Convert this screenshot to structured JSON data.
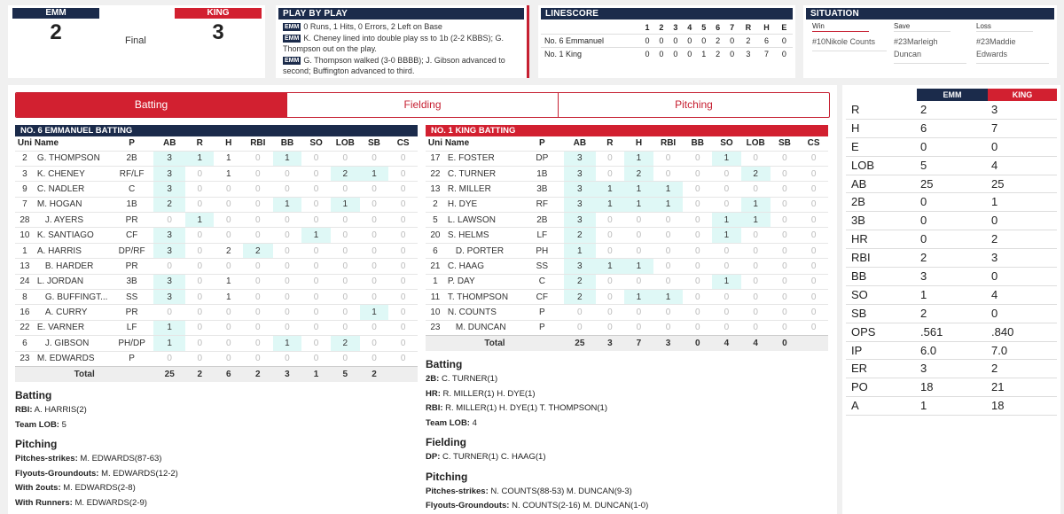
{
  "score": {
    "away": {
      "abbr": "EMM",
      "runs": "2",
      "color": "#1b2b4b"
    },
    "home": {
      "abbr": "KING",
      "runs": "3",
      "color": "#d22030"
    },
    "status": "Final"
  },
  "pbp": {
    "title": "PLAY BY PLAY",
    "lines": [
      {
        "team": "EMM",
        "text": "0 Runs, 1 Hits, 0 Errors, 2 Left on Base"
      },
      {
        "team": "EMM",
        "text": "K. Cheney lined into double play ss to 1b (2-2 KBBS); G. Thompson out on the play."
      },
      {
        "team": "EMM",
        "text": "G. Thompson walked (3-0 BBBB); J. Gibson advanced to second; Buffington advanced to third."
      }
    ]
  },
  "linescore": {
    "title": "LINESCORE",
    "headers": [
      "",
      "1",
      "2",
      "3",
      "4",
      "5",
      "6",
      "7",
      "R",
      "H",
      "E"
    ],
    "rows": [
      [
        "No. 6 Emmanuel",
        "0",
        "0",
        "0",
        "0",
        "0",
        "2",
        "0",
        "2",
        "6",
        "0"
      ],
      [
        "No. 1 King",
        "0",
        "0",
        "0",
        "0",
        "1",
        "2",
        "0",
        "3",
        "7",
        "0"
      ]
    ]
  },
  "situation": {
    "title": "SITUATION",
    "win": {
      "label": "Win",
      "value": "#10Nikole Counts"
    },
    "save": {
      "label": "Save",
      "value": "#23Marleigh Duncan"
    },
    "loss": {
      "label": "Loss",
      "value": "#23Maddie Edwards"
    }
  },
  "tabs": [
    "Batting",
    "Fielding",
    "Pitching"
  ],
  "away_batting": {
    "title": "NO. 6 EMMANUEL BATTING",
    "headers": [
      "Uni",
      "Name",
      "P",
      "AB",
      "R",
      "H",
      "RBI",
      "BB",
      "SO",
      "LOB",
      "SB",
      "CS"
    ],
    "rows": [
      [
        "2",
        "G. THOMPSON",
        "2B",
        "3",
        "1",
        "1",
        "0",
        "1",
        "0",
        "0",
        "0",
        "0"
      ],
      [
        "3",
        "K. CHENEY",
        "RF/LF",
        "3",
        "0",
        "1",
        "0",
        "0",
        "0",
        "2",
        "1",
        "0"
      ],
      [
        "9",
        "C. NADLER",
        "C",
        "3",
        "0",
        "0",
        "0",
        "0",
        "0",
        "0",
        "0",
        "0"
      ],
      [
        "7",
        "M. HOGAN",
        "1B",
        "2",
        "0",
        "0",
        "0",
        "1",
        "0",
        "1",
        "0",
        "0"
      ],
      [
        "28",
        "J. AYERS",
        "PR",
        "0",
        "1",
        "0",
        "0",
        "0",
        "0",
        "0",
        "0",
        "0"
      ],
      [
        "10",
        "K. SANTIAGO",
        "CF",
        "3",
        "0",
        "0",
        "0",
        "0",
        "1",
        "0",
        "0",
        "0"
      ],
      [
        "1",
        "A. HARRIS",
        "DP/RF",
        "3",
        "0",
        "2",
        "2",
        "0",
        "0",
        "0",
        "0",
        "0"
      ],
      [
        "13",
        "B. HARDER",
        "PR",
        "0",
        "0",
        "0",
        "0",
        "0",
        "0",
        "0",
        "0",
        "0"
      ],
      [
        "24",
        "L. JORDAN",
        "3B",
        "3",
        "0",
        "1",
        "0",
        "0",
        "0",
        "0",
        "0",
        "0"
      ],
      [
        "8",
        "G. BUFFINGT...",
        "SS",
        "3",
        "0",
        "1",
        "0",
        "0",
        "0",
        "0",
        "0",
        "0"
      ],
      [
        "16",
        "A. CURRY",
        "PR",
        "0",
        "0",
        "0",
        "0",
        "0",
        "0",
        "0",
        "1",
        "0"
      ],
      [
        "22",
        "E. VARNER",
        "LF",
        "1",
        "0",
        "0",
        "0",
        "0",
        "0",
        "0",
        "0",
        "0"
      ],
      [
        "6",
        "J. GIBSON",
        "PH/DP",
        "1",
        "0",
        "0",
        "0",
        "1",
        "0",
        "2",
        "0",
        "0"
      ],
      [
        "23",
        "M. EDWARDS",
        "P",
        "0",
        "0",
        "0",
        "0",
        "0",
        "0",
        "0",
        "0",
        "0"
      ]
    ],
    "total": [
      "Total",
      "25",
      "2",
      "6",
      "2",
      "3",
      "1",
      "5",
      "2",
      ""
    ]
  },
  "home_batting": {
    "title": "NO. 1 KING BATTING",
    "headers": [
      "Uni",
      "Name",
      "P",
      "AB",
      "R",
      "H",
      "RBI",
      "BB",
      "SO",
      "LOB",
      "SB",
      "CS"
    ],
    "rows": [
      [
        "17",
        "E. FOSTER",
        "DP",
        "3",
        "0",
        "1",
        "0",
        "0",
        "1",
        "0",
        "0",
        "0"
      ],
      [
        "22",
        "C. TURNER",
        "1B",
        "3",
        "0",
        "2",
        "0",
        "0",
        "0",
        "2",
        "0",
        "0"
      ],
      [
        "13",
        "R. MILLER",
        "3B",
        "3",
        "1",
        "1",
        "1",
        "0",
        "0",
        "0",
        "0",
        "0"
      ],
      [
        "2",
        "H. DYE",
        "RF",
        "3",
        "1",
        "1",
        "1",
        "0",
        "0",
        "1",
        "0",
        "0"
      ],
      [
        "5",
        "L. LAWSON",
        "2B",
        "3",
        "0",
        "0",
        "0",
        "0",
        "1",
        "1",
        "0",
        "0"
      ],
      [
        "20",
        "S. HELMS",
        "LF",
        "2",
        "0",
        "0",
        "0",
        "0",
        "1",
        "0",
        "0",
        "0"
      ],
      [
        "6",
        "D. PORTER",
        "PH",
        "1",
        "0",
        "0",
        "0",
        "0",
        "0",
        "0",
        "0",
        "0"
      ],
      [
        "21",
        "C. HAAG",
        "SS",
        "3",
        "1",
        "1",
        "0",
        "0",
        "0",
        "0",
        "0",
        "0"
      ],
      [
        "1",
        "P. DAY",
        "C",
        "2",
        "0",
        "0",
        "0",
        "0",
        "1",
        "0",
        "0",
        "0"
      ],
      [
        "11",
        "T. THOMPSON",
        "CF",
        "2",
        "0",
        "1",
        "1",
        "0",
        "0",
        "0",
        "0",
        "0"
      ],
      [
        "10",
        "N. COUNTS",
        "P",
        "0",
        "0",
        "0",
        "0",
        "0",
        "0",
        "0",
        "0",
        "0"
      ],
      [
        "23",
        "M. DUNCAN",
        "P",
        "0",
        "0",
        "0",
        "0",
        "0",
        "0",
        "0",
        "0",
        "0"
      ]
    ],
    "total": [
      "Total",
      "25",
      "3",
      "7",
      "3",
      "0",
      "4",
      "4",
      "0",
      ""
    ]
  },
  "away_notes": {
    "batting_title": "Batting",
    "batting": [
      {
        "label": "RBI:",
        "value": "A. HARRIS(2)"
      },
      {
        "label": "Team LOB:",
        "value": "5"
      }
    ],
    "pitching_title": "Pitching",
    "pitching": [
      {
        "label": "Pitches-strikes:",
        "value": "M. EDWARDS(87-63)"
      },
      {
        "label": "Flyouts-Groundouts:",
        "value": "M. EDWARDS(12-2)"
      },
      {
        "label": "With 2outs:",
        "value": "M. EDWARDS(2-8)"
      },
      {
        "label": "With Runners:",
        "value": "M. EDWARDS(2-9)"
      }
    ]
  },
  "home_notes": {
    "batting_title": "Batting",
    "batting": [
      {
        "label": "2B:",
        "value": "C. TURNER(1)"
      },
      {
        "label": "HR:",
        "value": "R. MILLER(1) H. DYE(1)"
      },
      {
        "label": "RBI:",
        "value": "R. MILLER(1) H. DYE(1) T. THOMPSON(1)"
      },
      {
        "label": "Team LOB:",
        "value": "4"
      }
    ],
    "fielding_title": "Fielding",
    "fielding": [
      {
        "label": "DP:",
        "value": "C. TURNER(1) C. HAAG(1)"
      }
    ],
    "pitching_title": "Pitching",
    "pitching": [
      {
        "label": "Pitches-strikes:",
        "value": "N. COUNTS(88-53) M. DUNCAN(9-3)"
      },
      {
        "label": "Flyouts-Groundouts:",
        "value": "N. COUNTS(2-16) M. DUNCAN(1-0)"
      }
    ]
  },
  "team_stats": {
    "headers": [
      "",
      "EMM",
      "KING"
    ],
    "rows": [
      [
        "R",
        "2",
        "3"
      ],
      [
        "H",
        "6",
        "7"
      ],
      [
        "E",
        "0",
        "0"
      ],
      [
        "LOB",
        "5",
        "4"
      ],
      [
        "AB",
        "25",
        "25"
      ],
      [
        "2B",
        "0",
        "1"
      ],
      [
        "3B",
        "0",
        "0"
      ],
      [
        "HR",
        "0",
        "2"
      ],
      [
        "RBI",
        "2",
        "3"
      ],
      [
        "BB",
        "3",
        "0"
      ],
      [
        "SO",
        "1",
        "4"
      ],
      [
        "SB",
        "2",
        "0"
      ],
      [
        "OPS",
        ".561",
        ".840"
      ],
      [
        "IP",
        "6.0",
        "7.0"
      ],
      [
        "ER",
        "3",
        "2"
      ],
      [
        "PO",
        "18",
        "21"
      ],
      [
        "A",
        "1",
        "18"
      ]
    ]
  }
}
